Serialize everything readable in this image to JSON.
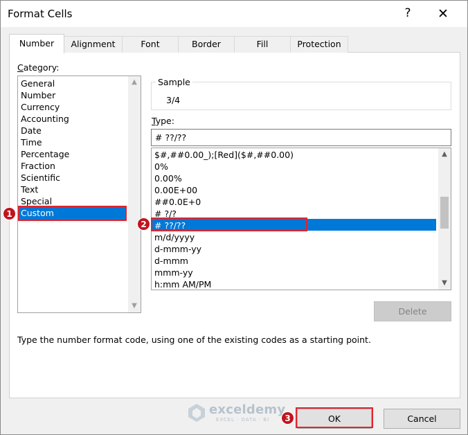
{
  "dialog": {
    "title": "Format Cells",
    "help_glyph": "?",
    "close_glyph": "✕"
  },
  "tabs": [
    {
      "label": "Number",
      "active": true
    },
    {
      "label": "Alignment",
      "active": false
    },
    {
      "label": "Font",
      "active": false
    },
    {
      "label": "Border",
      "active": false
    },
    {
      "label": "Fill",
      "active": false
    },
    {
      "label": "Protection",
      "active": false
    }
  ],
  "category": {
    "label": "Category:",
    "items": [
      "General",
      "Number",
      "Currency",
      "Accounting",
      "Date",
      "Time",
      "Percentage",
      "Fraction",
      "Scientific",
      "Text",
      "Special",
      "Custom"
    ],
    "selected": "Custom"
  },
  "sample": {
    "label": "Sample",
    "value": "3/4"
  },
  "type": {
    "label": "Type:",
    "value": "# ??/??",
    "items": [
      "$#,##0.00_);[Red]($#,##0.00)",
      "0%",
      "0.00%",
      "0.00E+00",
      "##0.0E+0",
      "# ?/?",
      "# ??/??",
      "m/d/yyyy",
      "d-mmm-yy",
      "d-mmm",
      "mmm-yy",
      "h:mm AM/PM"
    ],
    "selected": "# ??/??"
  },
  "buttons": {
    "delete": "Delete",
    "ok": "OK",
    "cancel": "Cancel"
  },
  "hint": "Type the number format code, using one of the existing codes as a starting point.",
  "callouts": [
    "1",
    "2",
    "3"
  ],
  "watermark": {
    "name": "exceldemy",
    "tagline": "EXCEL · DATA · BI"
  },
  "colors": {
    "selection": "#0078d7",
    "highlight": "#e0242d",
    "badge": "#c0151e"
  }
}
